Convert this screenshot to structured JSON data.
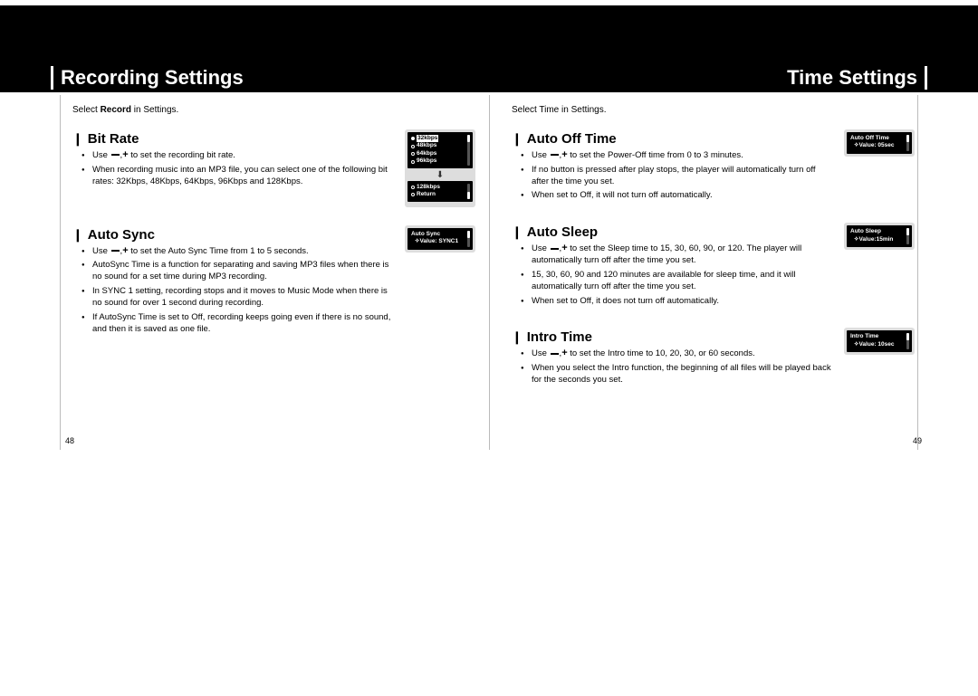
{
  "header": {
    "left": "Recording Settings",
    "right": "Time Settings"
  },
  "left_page": {
    "instruction_pre": "Select ",
    "instruction_bold": "Record",
    "instruction_post": " in Settings.",
    "page_number": "48",
    "sections": {
      "bitrate": {
        "title": "Bit Rate",
        "b1a": "Use ",
        "b1b": " to set the recording bit rate.",
        "b2": "When recording music into an MP3 file, you can select one of the following bit rates: 32Kbps, 48Kbps, 64Kbps, 96Kbps and 128Kbps.",
        "device_top": {
          "opt_sel": "32kbps",
          "opt2": "48kbps",
          "opt3": "64kbps",
          "opt4": "96kbps"
        },
        "device_bottom": {
          "opt1": "128kbps",
          "opt2": "Return"
        }
      },
      "autosync": {
        "title": "Auto Sync",
        "b1a": "Use ",
        "b1b": " to set the Auto Sync Time from 1 to 5 seconds.",
        "b2": "AutoSync Time is a function for separating and saving MP3 files when there is no sound for a set time during MP3 recording.",
        "b3": "In SYNC 1 setting, recording stops and it moves to Music Mode when there is no sound for over 1 second during recording.",
        "b4": "If AutoSync Time is set to Off, recording keeps going even if there is no sound, and then it is saved as one file.",
        "device": {
          "line1": "Auto Sync",
          "line2": "Value: SYNC1"
        }
      }
    }
  },
  "right_page": {
    "instruction": "Select Time in Settings.",
    "page_number": "49",
    "sections": {
      "autooff": {
        "title": "Auto Off Time",
        "b1a": "Use ",
        "b1b": " to set the Power-Off time from 0 to 3 minutes.",
        "b2": "If no button is pressed after play stops, the player will automatically turn off after the time you set.",
        "b3": "When set to Off, it will not turn off automatically.",
        "device": {
          "line1": "Auto Off Time",
          "line2": "Value: 05sec"
        }
      },
      "autosleep": {
        "title": "Auto Sleep",
        "b1a": "Use ",
        "b1b": " to set the Sleep time to 15, 30, 60, 90, or 120. The player will automatically turn off after the time you set.",
        "b2": "15, 30, 60, 90 and 120 minutes are available for sleep time, and it will automatically turn off after the time you set.",
        "b3": "When set to Off, it does not turn off automatically.",
        "device": {
          "line1": "Auto Sleep",
          "line2": "Value:15min"
        }
      },
      "intro": {
        "title": "Intro Time",
        "b1a": "Use ",
        "b1b": " to set the Intro time to 10, 20, 30, or 60 seconds.",
        "b2": "When you select the Intro function, the beginning of all files will be played back for the seconds you set.",
        "device": {
          "line1": "Intro Time",
          "line2": "Value: 10sec"
        }
      }
    }
  }
}
